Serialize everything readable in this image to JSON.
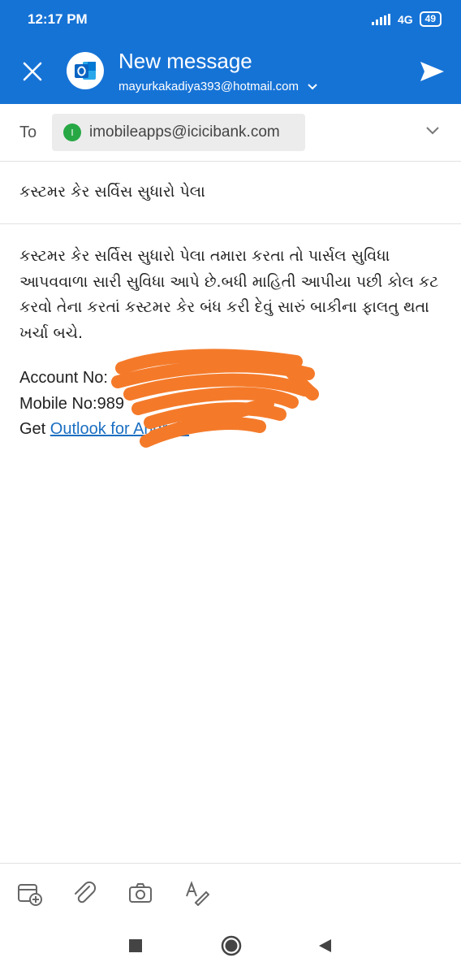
{
  "status_bar": {
    "time": "12:17 PM",
    "network": "4G",
    "battery": "49"
  },
  "header": {
    "title": "New message",
    "account": "mayurkakadiya393@hotmail.com"
  },
  "to": {
    "label": "To",
    "recipient_initial": "I",
    "recipient": "imobileapps@icicibank.com"
  },
  "subject": "કસ્ટમર કેર સર્વિસ સુધારો પેલા",
  "body": {
    "paragraph": "કસ્ટમર કેર સર્વિસ સુધારો પેલા તમારા કરતા તો પાર્સલ સુવિધા આપવવાળા સારી સુવિધા આપે છે.બધી માહિતી આપીયા પછી કોલ કટ કરવો તેના કરતાં કસ્ટમર કેર બંધ કરી દેવું સારું બાકીના ફાલતુ થતા ખર્ચા બચે.",
    "account_line": "Account No:",
    "mobile_line": "Mobile No:989",
    "signature_prefix": "Get ",
    "signature_link": "Outlook for Android"
  },
  "colors": {
    "header_bg": "#1673d6",
    "redaction": "#f47a2a",
    "link": "#1b6fc2"
  },
  "toolbar_icons": [
    "calendar-add-icon",
    "attach-icon",
    "camera-icon",
    "format-text-icon"
  ],
  "nav_icons": [
    "recent-apps-icon",
    "home-icon",
    "back-icon"
  ]
}
